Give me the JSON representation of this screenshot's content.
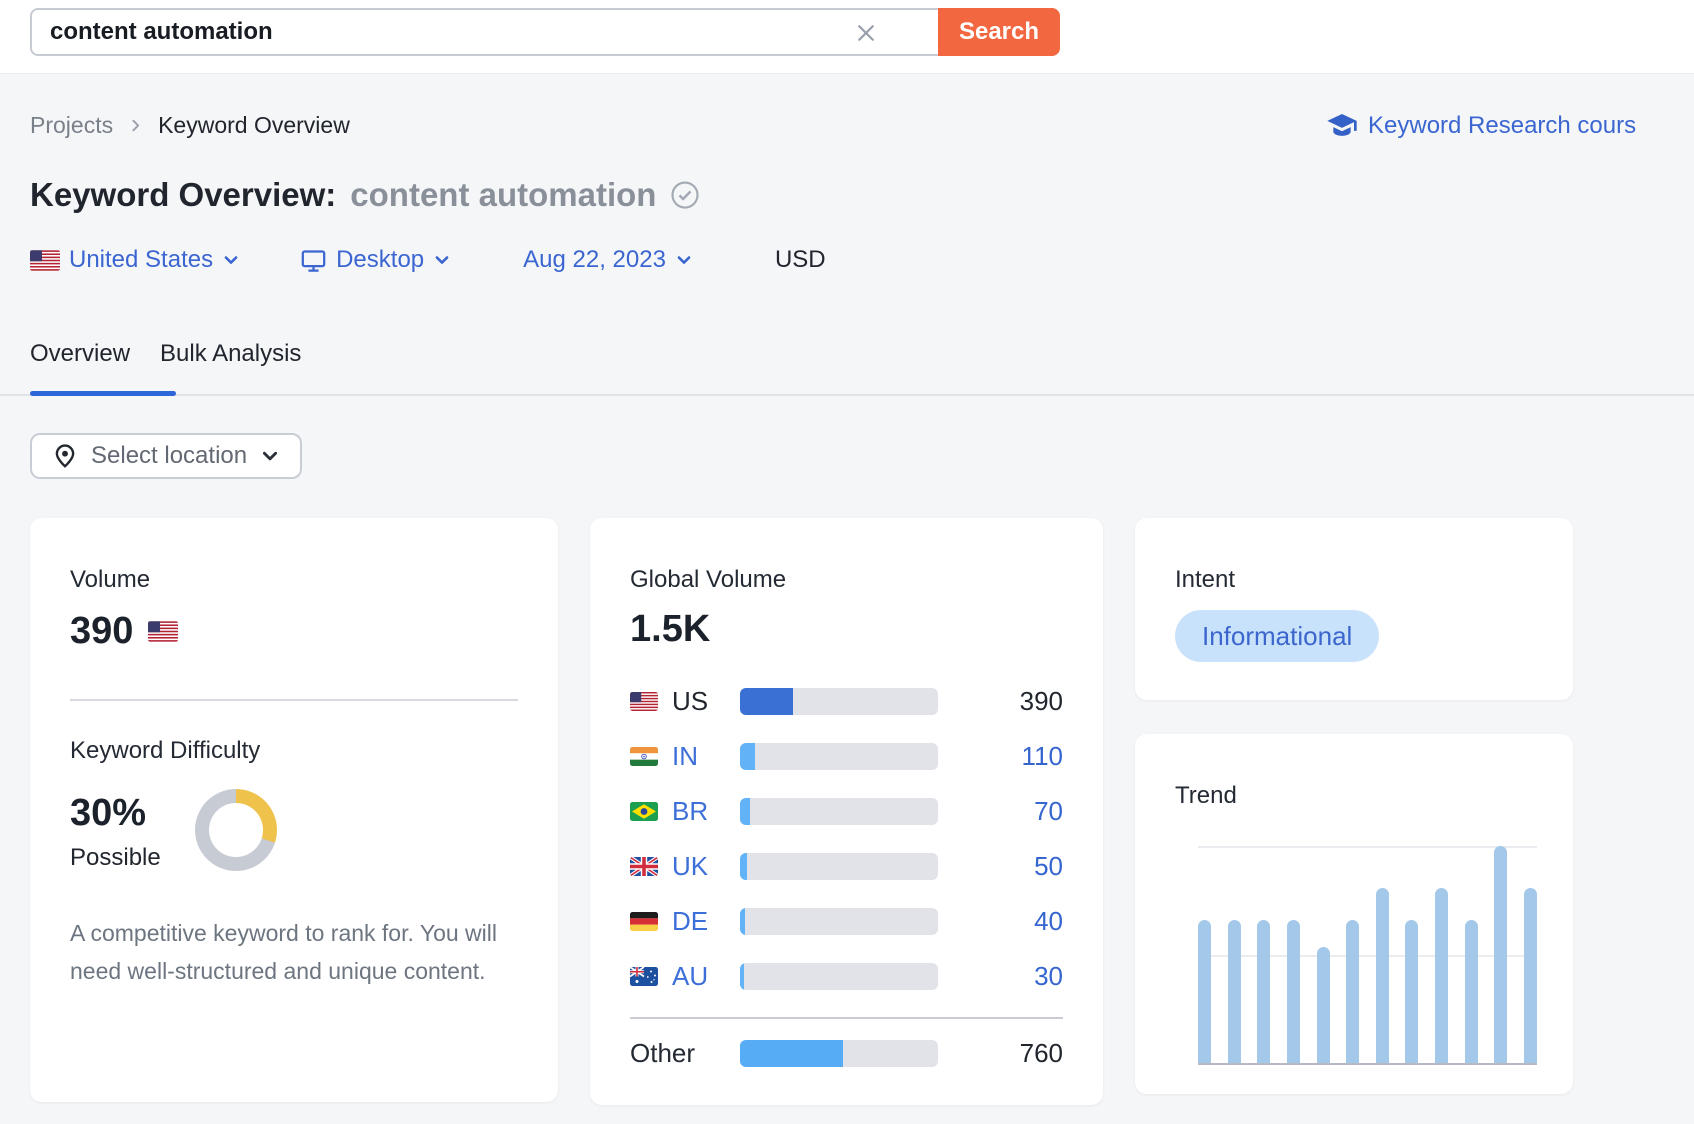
{
  "colors": {
    "accent_orange": "#f2673f",
    "link_blue": "#3b66d1",
    "tab_active_blue": "#2e65d9",
    "us_bar_blue": "#3a70d3",
    "country_bar_blue": "#62b2f7",
    "other_bar_blue": "#56acf5",
    "bar_track_gray": "#e1e3e9",
    "kd_donut_yellow": "#efc24c",
    "kd_donut_track": "#c7cbd3",
    "intent_badge_bg": "#c9e2fc",
    "intent_badge_text": "#3c66cd",
    "trend_bar_blue": "#a3c8e9"
  },
  "topbar": {
    "search_value": "content automation",
    "search_button": "Search"
  },
  "breadcrumb": {
    "items": [
      "Projects",
      "Keyword Overview"
    ]
  },
  "course_link": {
    "label": "Keyword Research cours"
  },
  "title": {
    "prefix": "Keyword Overview:",
    "keyword": "content automation"
  },
  "filters": {
    "country": "United States",
    "device": "Desktop",
    "date": "Aug 22, 2023",
    "currency": "USD"
  },
  "tabs": {
    "overview": "Overview",
    "bulk": "Bulk Analysis"
  },
  "location_selector": {
    "label": "Select location"
  },
  "cards": {
    "volume": {
      "label": "Volume",
      "value": "390"
    },
    "keyword_difficulty": {
      "label": "Keyword Difficulty",
      "value": "30%",
      "percent": 30,
      "qualifier": "Possible",
      "description": "A competitive keyword to rank for. You will need well-structured and unique content."
    },
    "global_volume": {
      "label": "Global Volume",
      "total": "1.5K",
      "rows": [
        {
          "code": "US",
          "value": "390",
          "share": 0.267,
          "highlight": true
        },
        {
          "code": "IN",
          "value": "110",
          "share": 0.075
        },
        {
          "code": "BR",
          "value": "70",
          "share": 0.048
        },
        {
          "code": "UK",
          "value": "50",
          "share": 0.034
        },
        {
          "code": "DE",
          "value": "40",
          "share": 0.027
        },
        {
          "code": "AU",
          "value": "30",
          "share": 0.021
        }
      ],
      "other": {
        "label": "Other",
        "value": "760",
        "share": 0.52
      }
    },
    "intent": {
      "label": "Intent",
      "badge": "Informational"
    },
    "trend": {
      "label": "Trend"
    }
  },
  "chart_data": {
    "type": "bar",
    "title": "Trend",
    "values": [
      0.66,
      0.66,
      0.66,
      0.66,
      0.54,
      0.66,
      0.81,
      0.66,
      0.81,
      0.66,
      1.0,
      0.81
    ],
    "ylim": [
      0,
      1
    ],
    "x_labels": [],
    "grid": "two horizontal gridlines plus baseline, no tick labels visible"
  }
}
